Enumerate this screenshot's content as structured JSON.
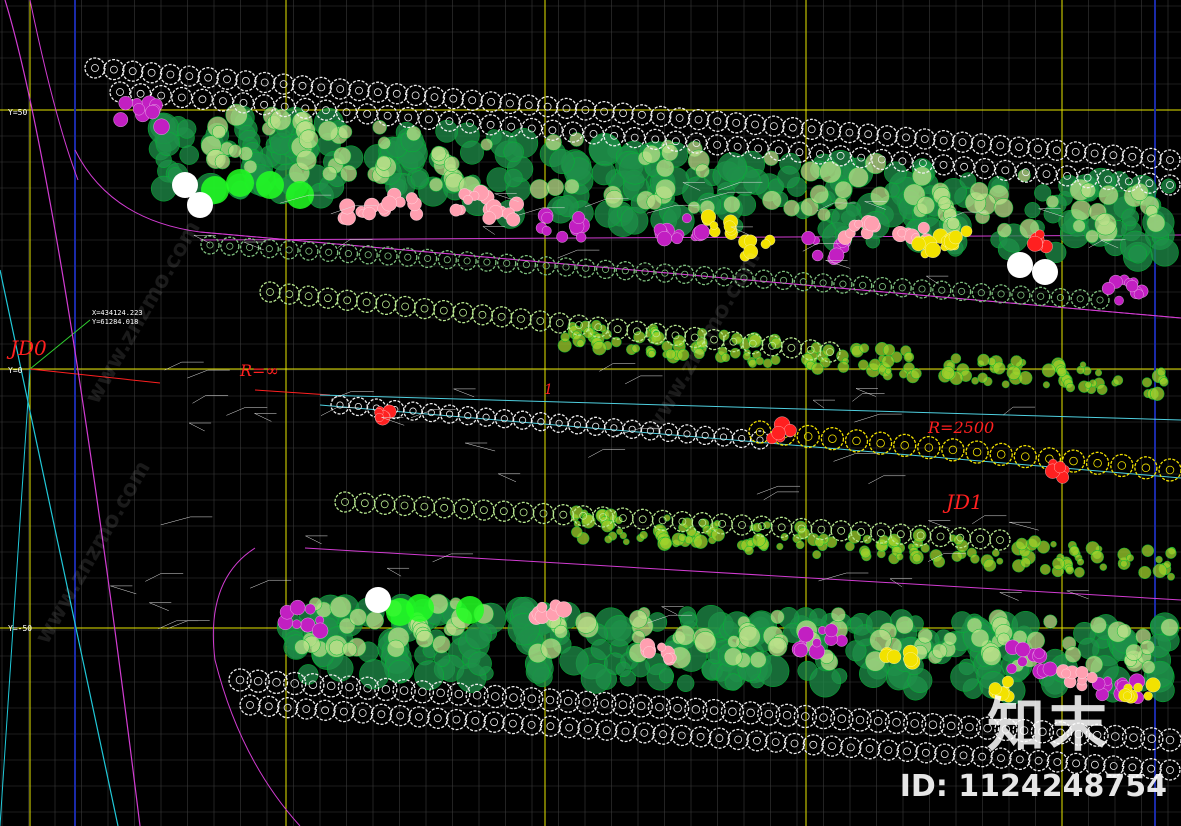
{
  "axis_labels": {
    "y_top": "Y=50",
    "y_mid": "Y=0",
    "y_bottom": "Y=-50"
  },
  "coordinates": {
    "x_value": "X=434124.223",
    "y_value": "Y=61284.018"
  },
  "curve_labels": {
    "jd0": "JD0",
    "jd1": "JD1",
    "radius_infinite": "R=∞",
    "radius_2500": "R=2500",
    "marker_1": "1"
  },
  "watermark": {
    "logo_text": "知末",
    "id_text": "ID: 1124248754",
    "diagonal_text": "www.znzmo.com"
  },
  "colors": {
    "background": "#000000",
    "grid_major": "#e6e600",
    "grid_minor": "#3a3a3a",
    "boundary": "#d23cd2",
    "tree_white": "#f0f0f0",
    "shrub_green": "#1f8f4a",
    "shrub_light": "#b9e08a",
    "flower_pink": "#ff9fb0",
    "flower_magenta": "#c21fc2",
    "flower_yellow": "#f2e200",
    "accent_red": "#ff2020",
    "bright_green": "#22ff22",
    "axis_cyan": "#20c8d8",
    "axis_blue": "#1a2aa8"
  },
  "icons": [
    "tree-symbol-icon",
    "shrub-cluster-icon",
    "flower-cluster-icon"
  ]
}
